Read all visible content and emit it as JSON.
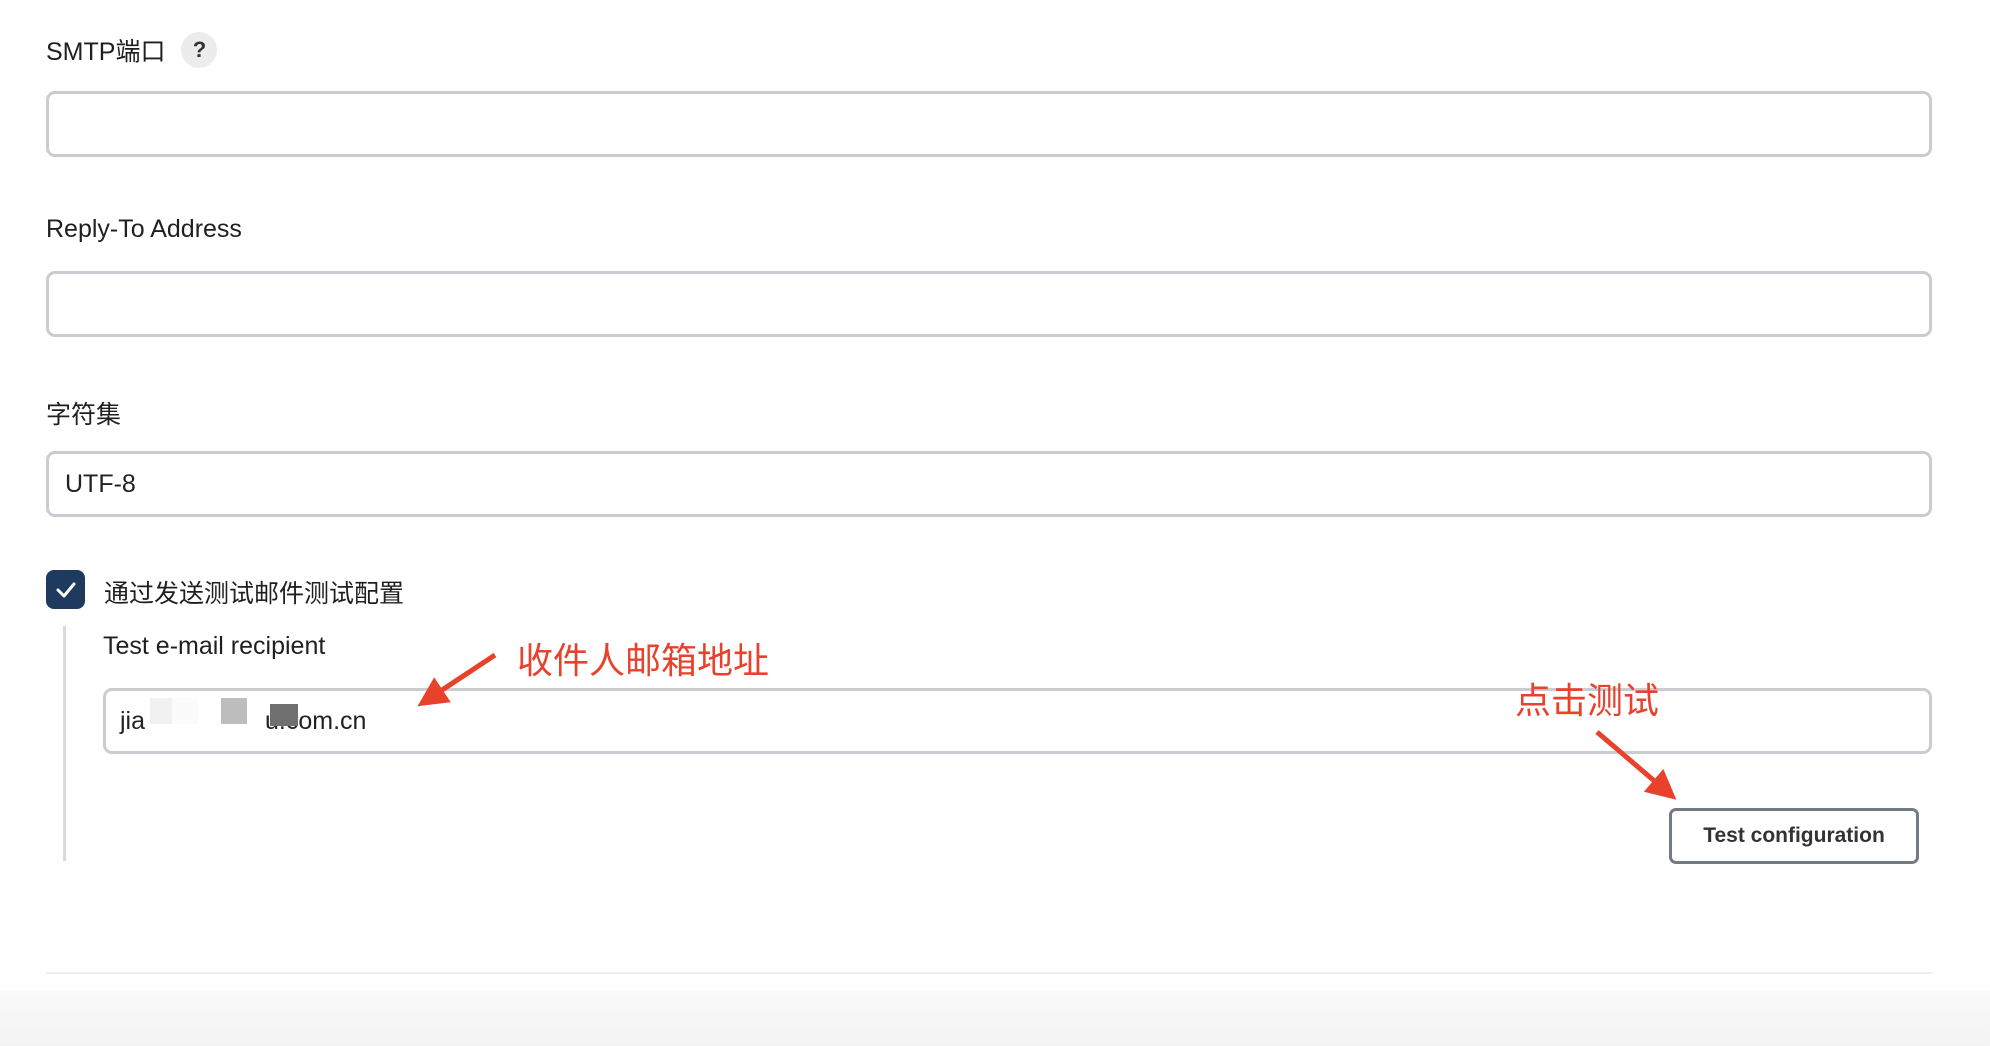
{
  "smtp_port": {
    "label": "SMTP端口",
    "help_glyph": "?",
    "value": ""
  },
  "reply_to": {
    "label": "Reply-To Address",
    "value": ""
  },
  "charset": {
    "label": "字符集",
    "value": "UTF-8"
  },
  "test_mail": {
    "checkbox_label": "通过发送测试邮件测试配置",
    "checked": true,
    "recipient_label": "Test e-mail recipient",
    "recipient_prefix": "jia",
    "recipient_suffix": "u.com.cn",
    "button_label": "Test configuration"
  },
  "annotations": {
    "recipient_note": "收件人邮箱地址",
    "click_note": "点击测试",
    "color": "#e8412c"
  },
  "colors": {
    "checkbox_fill": "#1e3a5f",
    "input_border": "#c9ccd1",
    "button_border": "#747a82"
  }
}
